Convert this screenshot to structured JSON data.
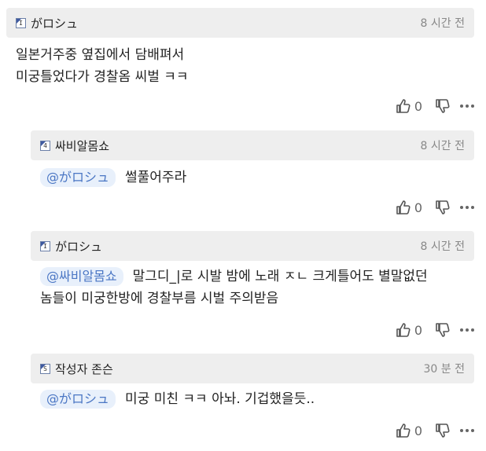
{
  "comments": [
    {
      "nickname": "がロシュ",
      "level": "I",
      "time": "8 시간 전",
      "text_line1": "일본거주중 옆집에서 담배펴서",
      "text_line2": "미궁틀었다가 경찰옴 씨벌 ㅋㅋ",
      "up_count": "0"
    },
    {
      "nickname": "싸비알몸쇼",
      "level": "4",
      "time": "8 시간 전",
      "mention": "@がロシュ",
      "text_line1": "썰풀어주라",
      "up_count": "0"
    },
    {
      "nickname": "がロシュ",
      "level": "I",
      "time": "8 시간 전",
      "mention": "@싸비알몸쇼",
      "text_line1": "말그디_|로 시발 밤에 노래 ㅈㄴ 크게틀어도 별말없던",
      "text_line2": "놈들이 미궁한방에 경찰부름 시벌 주의받음",
      "up_count": "0"
    },
    {
      "nickname": "작성자 존슨",
      "level": "S",
      "time": "30 분 전",
      "mention": "@がロシュ",
      "text_line1": "미궁 미친 ㅋㅋ 아놔. 기겁했을듯..",
      "up_count": "0"
    }
  ],
  "icons": {
    "up": "thumb-up-icon",
    "down": "thumb-down-icon",
    "more": "more-dots-icon"
  },
  "colors": {
    "header_bg": "#eeeeee",
    "mention_bg": "#e8f0fb",
    "mention_text": "#4a76c4"
  }
}
